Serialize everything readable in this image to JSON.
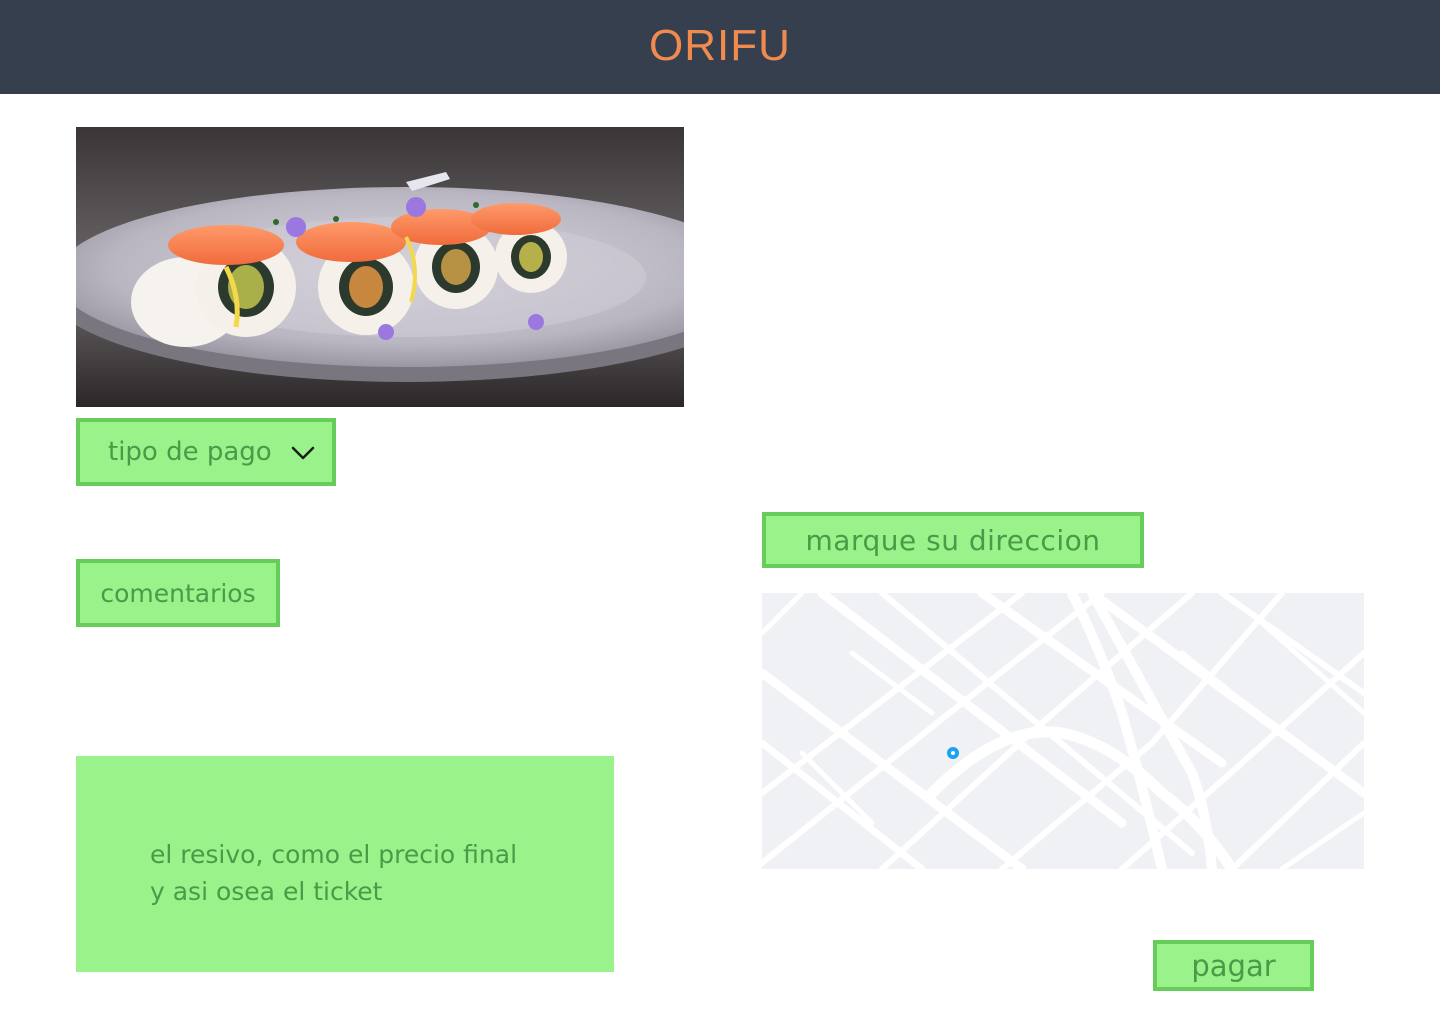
{
  "header": {
    "title": "ORIFU"
  },
  "hero_image": {
    "subject": "sushi rolls on a plate"
  },
  "payment": {
    "label": "tipo de pago",
    "icon": "chevron-down-icon"
  },
  "comments": {
    "label": "comentarios"
  },
  "address": {
    "label": "marque su direccion"
  },
  "map": {
    "pin_icon": "location-pin-icon"
  },
  "receipt": {
    "line1": "el resivo, como el precio final",
    "line2": "y asi osea el ticket"
  },
  "pay": {
    "label": "pagar"
  },
  "colors": {
    "header_bg": "#353f4d",
    "brand": "#f08a4f",
    "button_bg": "#99f28a",
    "button_border": "#66cc5a",
    "button_text": "#4a9a48",
    "map_bg": "#eff1f5",
    "map_pin": "#1da1f2"
  }
}
